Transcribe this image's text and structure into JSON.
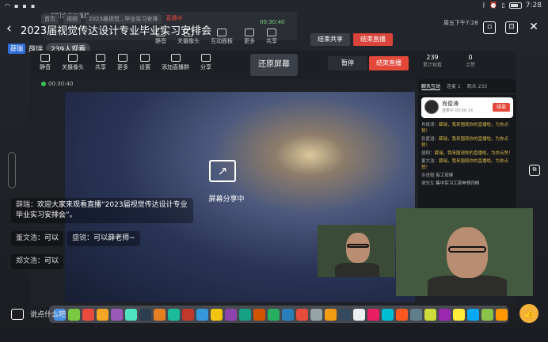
{
  "status_bar": {
    "time": "7:28",
    "battery_glyph": "battery-icon",
    "left_icons": [
      "wifi-icon",
      "notification-icon",
      "notification-icon",
      "notification-icon"
    ],
    "right_icons": [
      "bluetooth-icon",
      "alarm-icon",
      "vibrate-icon"
    ]
  },
  "header": {
    "title": "2023届视觉传达设计专业毕业实习安排会",
    "icons": [
      "floating-window-icon",
      "screen-cast-icon",
      "close-icon"
    ]
  },
  "host": {
    "badge": "薛瑞",
    "name": "薛瑞",
    "viewers": "239人观看"
  },
  "outer_window": {
    "title": "钉钉会议与直播",
    "tabs": [
      "首页",
      "视频",
      "2023届视觉...毕业实习安排"
    ],
    "timer": "00:30:40",
    "tools": [
      {
        "label": "静音",
        "icon": "mic-icon"
      },
      {
        "label": "关摄像头",
        "icon": "camera-icon"
      },
      {
        "label": "互动面板",
        "icon": "panel-icon"
      },
      {
        "label": "更多",
        "icon": "more-icon"
      },
      {
        "label": "共享",
        "icon": "share-icon"
      }
    ],
    "end_share_label": "结束共享",
    "end_live_label": "结束直播",
    "live_badge": "直播中",
    "clock": "周五下午7:28"
  },
  "app": {
    "tools": [
      {
        "label": "静音",
        "icon": "mic-icon"
      },
      {
        "label": "关摄像头",
        "icon": "camera-icon"
      },
      {
        "label": "共享",
        "icon": "share-icon"
      },
      {
        "label": "更多",
        "icon": "more-icon"
      },
      {
        "label": "设置",
        "icon": "settings-icon"
      },
      {
        "label": "添加直播群",
        "icon": "add-group-icon"
      },
      {
        "label": "分享",
        "icon": "forward-icon"
      }
    ],
    "restore_label": "还原屏幕",
    "pause_label": "暂停",
    "end_label": "结束直播",
    "stats": [
      {
        "value": "239",
        "label": "累计观看"
      },
      {
        "value": "0",
        "label": "点赞"
      }
    ],
    "timer": "00:30:40",
    "share_text": "屏幕分享中"
  },
  "chat_panel": {
    "tabs": [
      "聊天互动",
      "连麦 1",
      "观众 233"
    ],
    "presenter": {
      "name": "肖俊涛",
      "sub": "连麦中 00:00:14",
      "end_label": "结束"
    },
    "messages": [
      {
        "user": "肖俊涛：",
        "text": "薛瑞，我来围观你的直播啦，为你点赞！"
      },
      {
        "user": "张夏涵：",
        "text": "薛瑞，我来围观你的直播啦，为你点赞！"
      },
      {
        "user": "盛栩：",
        "text": "薛瑞，我来围观你的直播啦，为你点赞！"
      },
      {
        "user": "董文浩：",
        "text": "薛瑞，我来围观你的直播啦，为你点赞！"
      },
      {
        "user": "许进毅",
        "text": "有工安排"
      },
      {
        "user": "谢先生",
        "text": "集中实习工资申领归档"
      }
    ]
  },
  "comments": [
    {
      "user": "薛瑞：",
      "text": "欢迎大家来观看直播“2023届视觉传达设计专业毕业实习安排会”。"
    },
    {
      "user": "董文浩：",
      "text": "可以"
    },
    {
      "user": "盛锐：",
      "text": "可以薛老师~"
    },
    {
      "user": "郑文浩：",
      "text": "可以"
    }
  ],
  "bottom": {
    "input_placeholder": "说点什么吧",
    "like_icon": "thumbs-up-icon"
  },
  "dock_colors": [
    "#4a90e2",
    "#7ac943",
    "#e94b3c",
    "#f5a623",
    "#9b59b6",
    "#50e3c2",
    "#2c3e50",
    "#e67e22",
    "#1abc9c",
    "#c0392b",
    "#3498db",
    "#f1c40f",
    "#8e44ad",
    "#16a085",
    "#d35400",
    "#27ae60",
    "#2980b9",
    "#e74c3c",
    "#95a5a6",
    "#f39c12",
    "#34495e",
    "#ecf0f1",
    "#e91e63",
    "#00bcd4",
    "#ff5722",
    "#607d8b",
    "#cddc39",
    "#9c27b0",
    "#ffeb3b",
    "#03a9f4",
    "#8bc34a",
    "#ff9800"
  ]
}
